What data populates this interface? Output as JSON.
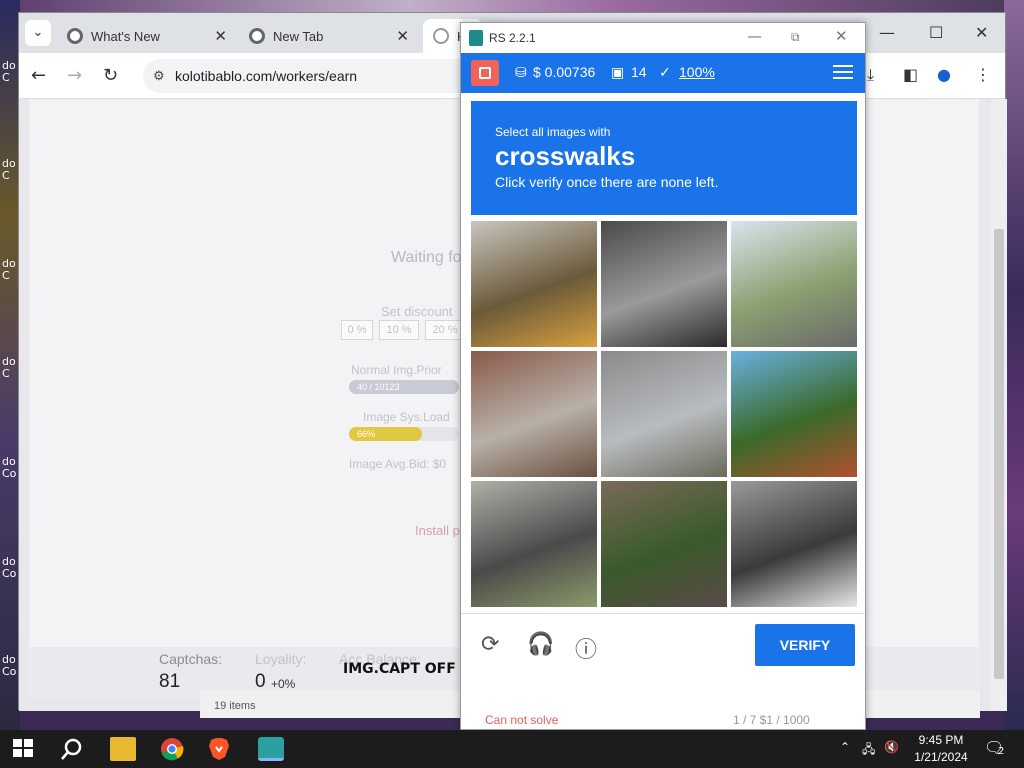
{
  "desktop": {
    "icon_labels": [
      "do\nC",
      "do\nC",
      "do\nC",
      "do\nC",
      "do\nCo",
      "do\nCo",
      "do\nCo"
    ]
  },
  "browser": {
    "tabs": [
      {
        "title": "What's New"
      },
      {
        "title": "New Tab"
      },
      {
        "title": "K"
      }
    ],
    "url": "kolotibablo.com/workers/earn"
  },
  "page": {
    "waiting": "Waiting fo",
    "set_discount": "Set discount",
    "discounts": [
      "0 %",
      "10 %",
      "20 %"
    ],
    "normal_img_prior": "Normal Img.Prior",
    "normal_bar_text": "40 / 10123",
    "image_sys_load": "Image Sys.Load",
    "load_bar_text": "66%",
    "load_fraction": 0.66,
    "image_avg_bid": "Image Avg.Bid: $0",
    "install": "Install p",
    "stats": {
      "captchas_label": "Captchas:",
      "captchas_value": "81",
      "loyalty_label": "Loyality:",
      "loyalty_value": "0",
      "loyalty_delta": "+0%",
      "acc_balance_label": "Acc.Balance:",
      "img_capt": "IMG.CAPT OFF"
    },
    "bottom_text": "19 items"
  },
  "popup": {
    "title": "RS 2.2.1",
    "balance": "$ 0.00736",
    "images_count": "14",
    "accuracy": "100%",
    "challenge": {
      "line1": "Select all images with",
      "keyword": "crosswalks",
      "line3": "Click verify once there are none left."
    },
    "tiles": [
      {
        "name": "traffic-light-tile",
        "colors": [
          "#c9c5bf",
          "#6b5a3a",
          "#d8a040"
        ]
      },
      {
        "name": "motorcycles-parked-tile",
        "colors": [
          "#4a4a4a",
          "#9a9a9a",
          "#2a2a2a"
        ]
      },
      {
        "name": "arch-bridge-tile",
        "colors": [
          "#d8e4ee",
          "#8aa070",
          "#6a6a6a"
        ]
      },
      {
        "name": "building-shutter-tile",
        "colors": [
          "#8a5a4a",
          "#b8b0a8",
          "#6a5040"
        ]
      },
      {
        "name": "road-car-tile",
        "colors": [
          "#8a8a8a",
          "#b8bcc0",
          "#6a6a5a"
        ]
      },
      {
        "name": "traffic-light-street-tile",
        "colors": [
          "#6ab0e0",
          "#3a6a2a",
          "#b05030"
        ]
      },
      {
        "name": "cyclists-tile",
        "colors": [
          "#b0b0a8",
          "#4a4a4a",
          "#8a9a6a"
        ]
      },
      {
        "name": "motorcyclist-tile",
        "colors": [
          "#7a6a5a",
          "#3a5a2a",
          "#5a4a4a"
        ]
      },
      {
        "name": "parked-motorbikes-tile",
        "colors": [
          "#9a9a9a",
          "#3a3a3a",
          "#e8e8e8"
        ]
      }
    ],
    "verify": "VERIFY",
    "footer_left": "Can not solve",
    "footer_right": "1 / 7    $1 / 1000"
  },
  "taskbar": {
    "time": "9:45 PM",
    "date": "1/21/2024",
    "notif_count": "2"
  }
}
